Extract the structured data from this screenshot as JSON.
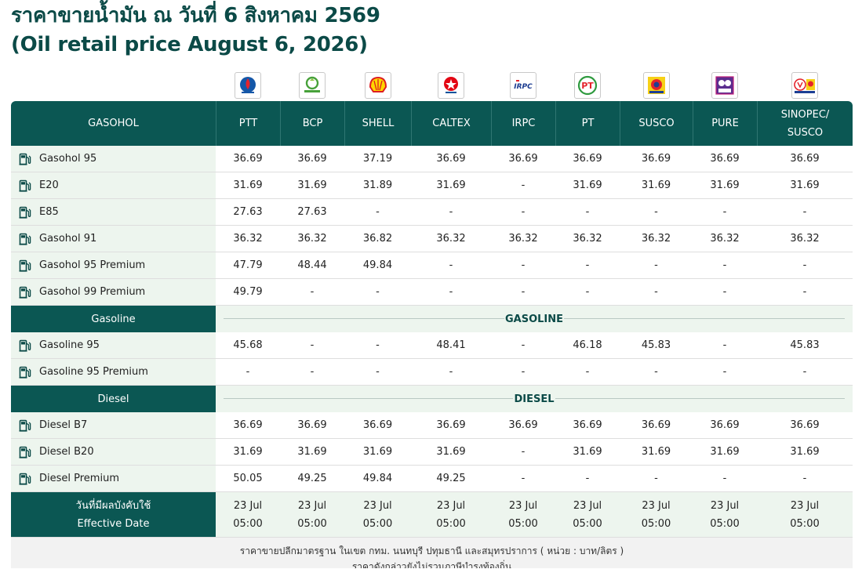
{
  "title": {
    "line1": "ราคาขายน้ำมัน ณ วันที่ 6 สิงหาคม 2569",
    "line2": "(Oil retail price August 6, 2026)"
  },
  "header": {
    "label": "GASOHOL",
    "brands": [
      {
        "name": "PTT",
        "logo": "ptt-logo"
      },
      {
        "name": "BCP",
        "logo": "bangchak-logo"
      },
      {
        "name": "SHELL",
        "logo": "shell-logo"
      },
      {
        "name": "CALTEX",
        "logo": "caltex-logo"
      },
      {
        "name": "IRPC",
        "logo": "irpc-logo"
      },
      {
        "name": "PT",
        "logo": "pt-logo"
      },
      {
        "name": "SUSCO",
        "logo": "susco-logo"
      },
      {
        "name": "PURE",
        "logo": "pure-logo"
      },
      {
        "name": "SINOPEC/\nSUSCO",
        "logo": "sinopec-susco-logo"
      }
    ]
  },
  "sections": [
    {
      "label": "",
      "divider": "",
      "rows": [
        {
          "fuel": "Gasohol 95",
          "prices": [
            "36.69",
            "36.69",
            "37.19",
            "36.69",
            "36.69",
            "36.69",
            "36.69",
            "36.69",
            "36.69"
          ]
        },
        {
          "fuel": "E20",
          "prices": [
            "31.69",
            "31.69",
            "31.89",
            "31.69",
            "-",
            "31.69",
            "31.69",
            "31.69",
            "31.69"
          ]
        },
        {
          "fuel": "E85",
          "prices": [
            "27.63",
            "27.63",
            "-",
            "-",
            "-",
            "-",
            "-",
            "-",
            "-"
          ]
        },
        {
          "fuel": "Gasohol 91",
          "prices": [
            "36.32",
            "36.32",
            "36.82",
            "36.32",
            "36.32",
            "36.32",
            "36.32",
            "36.32",
            "36.32"
          ]
        },
        {
          "fuel": "Gasohol 95 Premium",
          "prices": [
            "47.79",
            "48.44",
            "49.84",
            "-",
            "-",
            "-",
            "-",
            "-",
            "-"
          ]
        },
        {
          "fuel": "Gasohol 99 Premium",
          "prices": [
            "49.79",
            "-",
            "-",
            "-",
            "-",
            "-",
            "-",
            "-",
            "-"
          ]
        }
      ]
    },
    {
      "label": "Gasoline",
      "divider": "GASOLINE",
      "rows": [
        {
          "fuel": "Gasoline 95",
          "prices": [
            "45.68",
            "-",
            "-",
            "48.41",
            "-",
            "46.18",
            "45.83",
            "-",
            "45.83"
          ]
        },
        {
          "fuel": "Gasoline 95 Premium",
          "prices": [
            "-",
            "-",
            "-",
            "-",
            "-",
            "-",
            "-",
            "-",
            "-"
          ]
        }
      ]
    },
    {
      "label": "Diesel",
      "divider": "DIESEL",
      "rows": [
        {
          "fuel": "Diesel B7",
          "prices": [
            "36.69",
            "36.69",
            "36.69",
            "36.69",
            "36.69",
            "36.69",
            "36.69",
            "36.69",
            "36.69"
          ]
        },
        {
          "fuel": "Diesel B20",
          "prices": [
            "31.69",
            "31.69",
            "31.69",
            "31.69",
            "-",
            "31.69",
            "31.69",
            "31.69",
            "31.69"
          ]
        },
        {
          "fuel": "Diesel Premium",
          "prices": [
            "50.05",
            "49.25",
            "49.84",
            "49.25",
            "-",
            "-",
            "-",
            "-",
            "-"
          ]
        }
      ]
    }
  ],
  "effective": {
    "label_th": "วันที่มีผลบังคับใช้",
    "label_en": "Effective Date",
    "dates": [
      {
        "date": "23 Jul",
        "time": "05:00"
      },
      {
        "date": "23 Jul",
        "time": "05:00"
      },
      {
        "date": "23 Jul",
        "time": "05:00"
      },
      {
        "date": "23 Jul",
        "time": "05:00"
      },
      {
        "date": "23 Jul",
        "time": "05:00"
      },
      {
        "date": "23 Jul",
        "time": "05:00"
      },
      {
        "date": "23 Jul",
        "time": "05:00"
      },
      {
        "date": "23 Jul",
        "time": "05:00"
      },
      {
        "date": "23 Jul",
        "time": "05:00"
      }
    ]
  },
  "footnote": {
    "line1": "ราคาขายปลีกมาตรฐาน ในเขต กทม. นนทบุรี ปทุมธานี และสมุทรปราการ ( หน่วย : บาท/ลิตร )",
    "line2": "ราคาดังกล่าวยังไม่รวมภาษีบำรุงท้องถิ่น"
  },
  "colors": {
    "header_bg": "#0b5753",
    "label_bg": "#edf5ee",
    "title": "#0b4a47"
  },
  "icons": {
    "fuel_row": "fuel-pump-icon"
  }
}
